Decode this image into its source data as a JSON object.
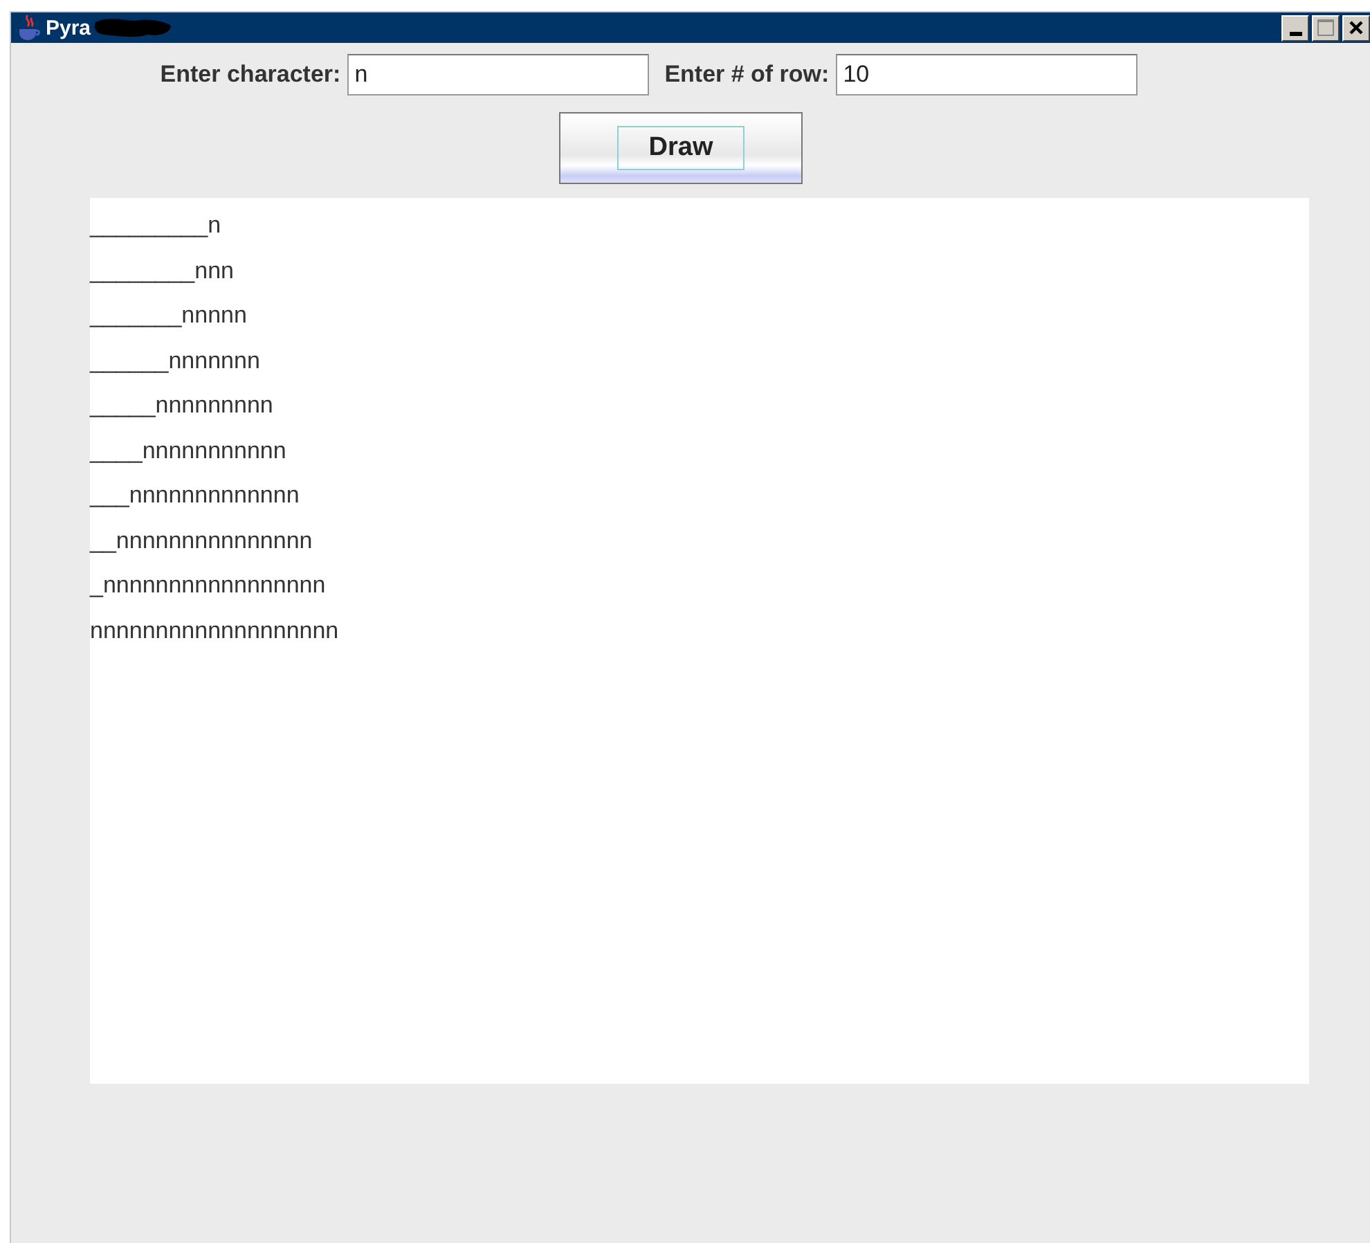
{
  "window": {
    "title": "Pyra"
  },
  "form": {
    "character_label": "Enter character:",
    "character_value": "n",
    "rows_label": "Enter # of row:",
    "rows_value": "10",
    "draw_button": "Draw"
  },
  "output": {
    "lines": [
      "_________n",
      "________nnn",
      "_______nnnnn",
      "______nnnnnnn",
      "_____nnnnnnnnn",
      "____nnnnnnnnnnn",
      "___nnnnnnnnnnnnn",
      "__nnnnnnnnnnnnnnn",
      "_nnnnnnnnnnnnnnnnn",
      "nnnnnnnnnnnnnnnnnnn"
    ]
  }
}
